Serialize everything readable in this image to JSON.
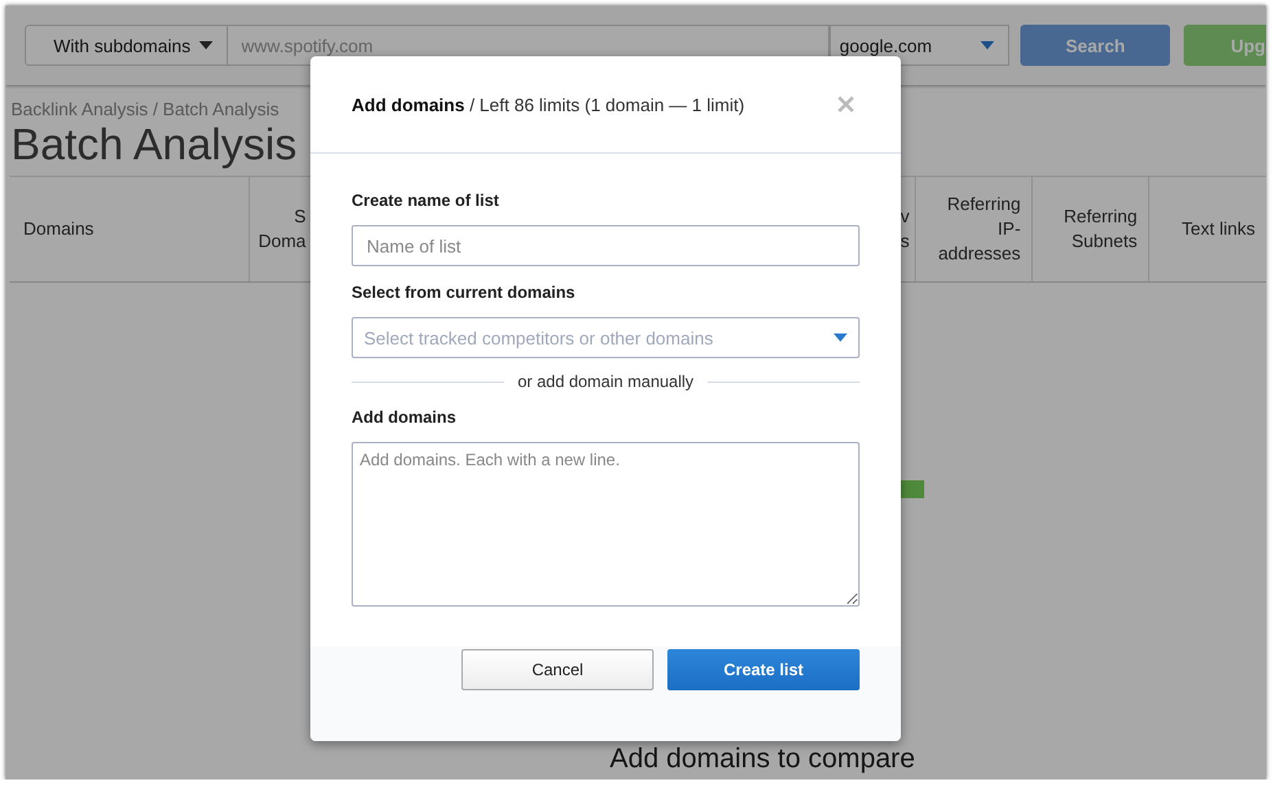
{
  "toolbar": {
    "scope_select": {
      "value": "With subdomains"
    },
    "domain_input": {
      "placeholder": "www.spotify.com"
    },
    "engine_select": {
      "value": "google.com"
    },
    "search_button": "Search",
    "upgrade_button": "Upg"
  },
  "breadcrumb": "Backlink Analysis / Batch Analysis",
  "page_title": "Batch Analysis",
  "table": {
    "columns": [
      {
        "label": "Domains"
      },
      {
        "label": "S\nDoma"
      },
      {
        "label": "v\ns"
      },
      {
        "label": "Referring IP-addresses"
      },
      {
        "label": "Referring Subnets"
      },
      {
        "label": "Text links"
      }
    ]
  },
  "empty_state": "Add domains to compare",
  "dialog": {
    "title": "**Add domains** / Left 86 limits (1 domain — 1 limit)",
    "name_label": "Create name of list",
    "name_field": {
      "placeholder": "Name of list"
    },
    "select_label": "Select from current domains",
    "select_field": {
      "placeholder": "Select tracked competitors or other domains"
    },
    "divider_text": "or add domain manually",
    "domains_label": "Add domains",
    "domains_field": {
      "placeholder": "Add domains. Each with a new line."
    },
    "buttons": [
      {
        "label": "Cancel",
        "kind": "secondary"
      },
      {
        "label": "Create list",
        "kind": "primary"
      }
    ]
  }
}
